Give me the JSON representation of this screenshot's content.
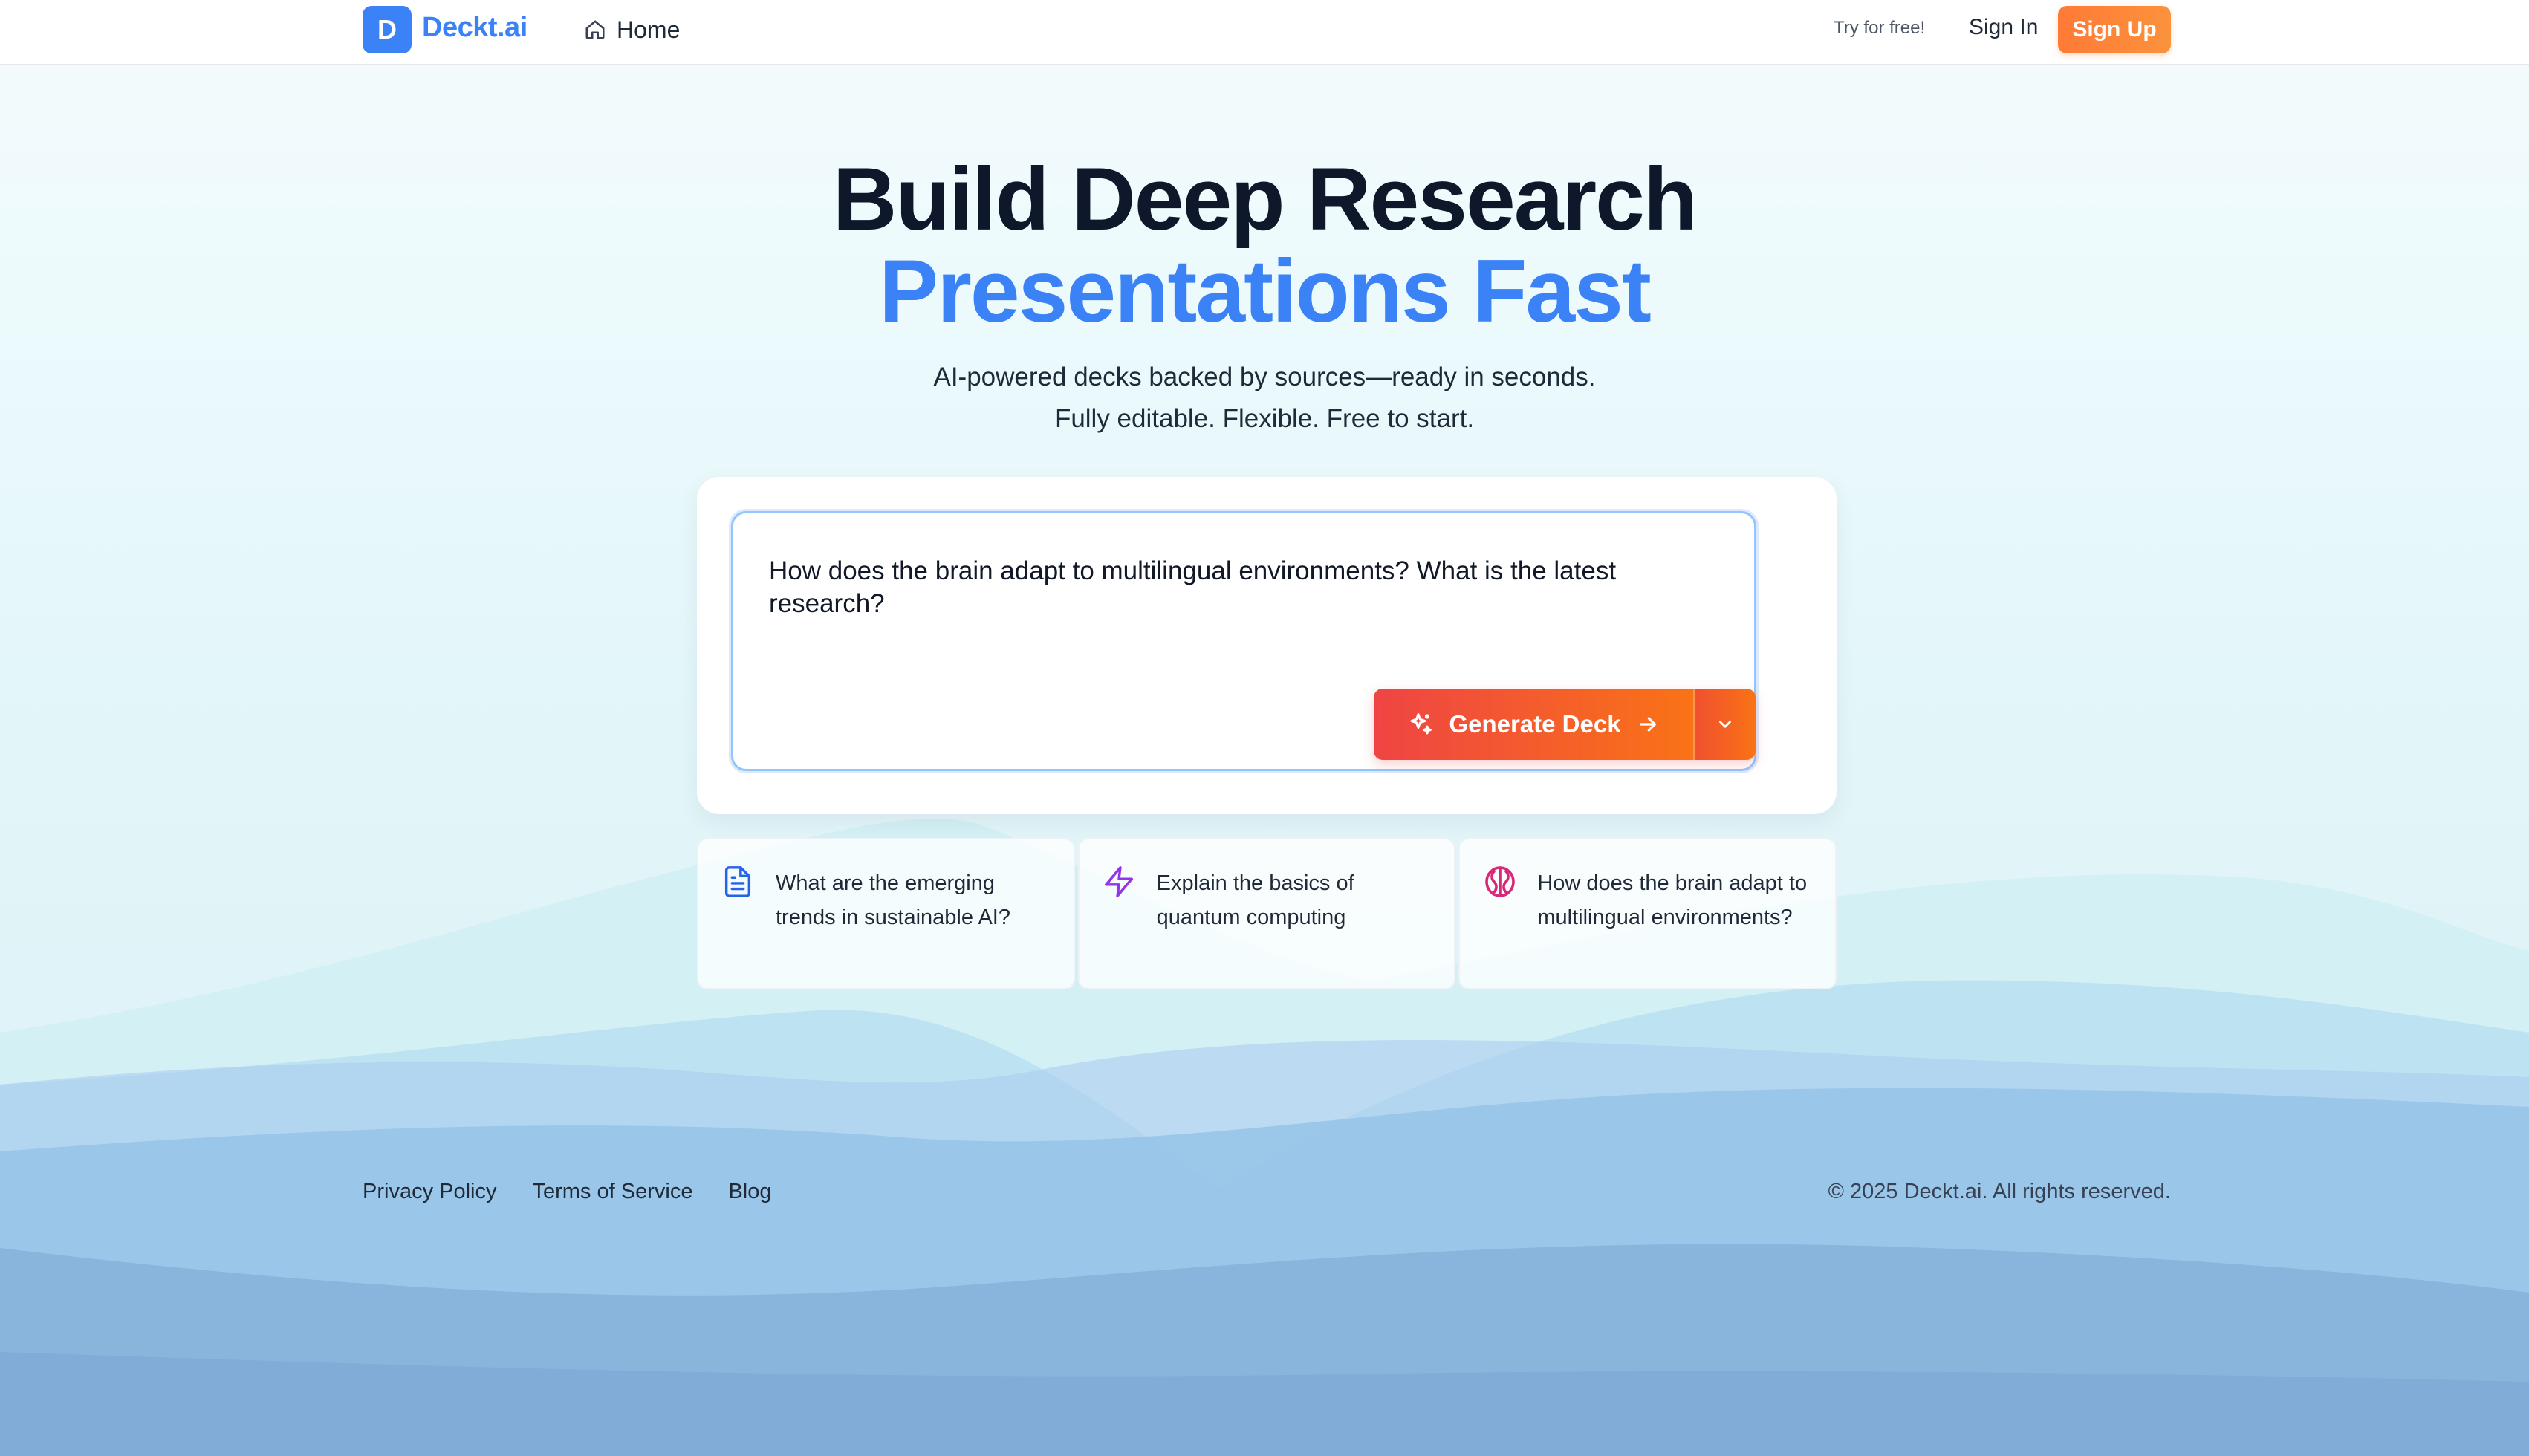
{
  "header": {
    "logo_letter": "D",
    "brand": "Deckt.ai",
    "home_label": "Home",
    "try_free": "Try for free!",
    "sign_in": "Sign In",
    "sign_up": "Sign Up"
  },
  "hero": {
    "title_line1": "Build Deep Research",
    "title_line2": "Presentations Fast",
    "subtitle_line1": "AI-powered decks backed by sources—ready in seconds.",
    "subtitle_line2": "Fully editable. Flexible. Free to start."
  },
  "prompt": {
    "value": "How does the brain adapt to multilingual environments? What is the latest research?",
    "generate_label": "Generate Deck"
  },
  "suggestions": [
    {
      "text": "What are the emerging trends in sustainable AI?",
      "icon": "document-icon"
    },
    {
      "text": "Explain the basics of quantum computing",
      "icon": "lightning-icon"
    },
    {
      "text": "How does the brain adapt to multilingual environments?",
      "icon": "brain-icon"
    }
  ],
  "footer": {
    "links": [
      "Privacy Policy",
      "Terms of Service",
      "Blog"
    ],
    "copyright": "© 2025 Deckt.ai. All rights reserved."
  },
  "colors": {
    "brand_blue": "#3b82f6",
    "accent_orange": "#f97316",
    "accent_red": "#ef4444"
  }
}
